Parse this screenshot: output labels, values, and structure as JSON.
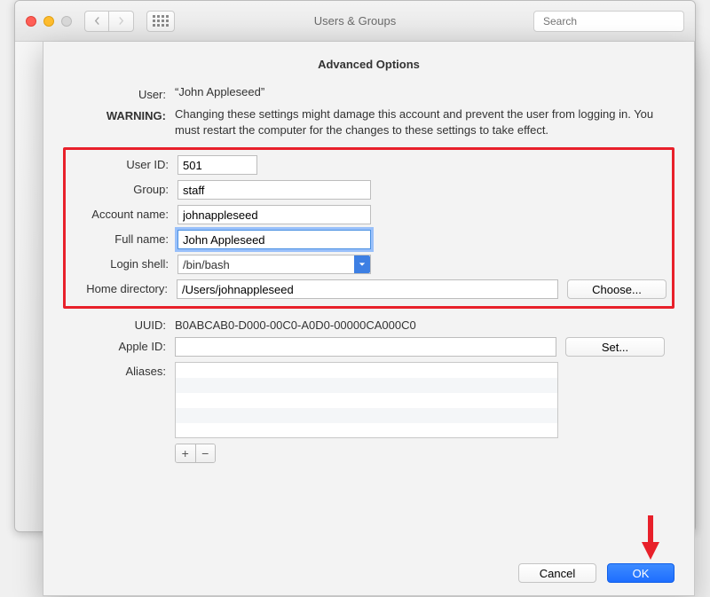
{
  "window": {
    "title": "Users & Groups",
    "search_placeholder": "Search"
  },
  "sheet": {
    "title": "Advanced Options",
    "user_label": "User:",
    "user_value": "“John Appleseed”",
    "warning_label": "WARNING:",
    "warning_text": "Changing these settings might damage this account and prevent the user from logging in. You must restart the computer for the changes to these settings to take effect.",
    "labels": {
      "user_id": "User ID:",
      "group": "Group:",
      "account_name": "Account name:",
      "full_name": "Full name:",
      "login_shell": "Login shell:",
      "home_dir": "Home directory:",
      "uuid": "UUID:",
      "apple_id": "Apple ID:",
      "aliases": "Aliases:"
    },
    "values": {
      "user_id": "501",
      "group": "staff",
      "account_name": "johnappleseed",
      "full_name": "John Appleseed",
      "login_shell": "/bin/bash",
      "home_dir": "/Users/johnappleseed",
      "uuid": "B0ABCAB0-D000-00C0-A0D0-00000CA000C0",
      "apple_id": ""
    },
    "buttons": {
      "choose": "Choose...",
      "set": "Set...",
      "cancel": "Cancel",
      "ok": "OK"
    }
  }
}
